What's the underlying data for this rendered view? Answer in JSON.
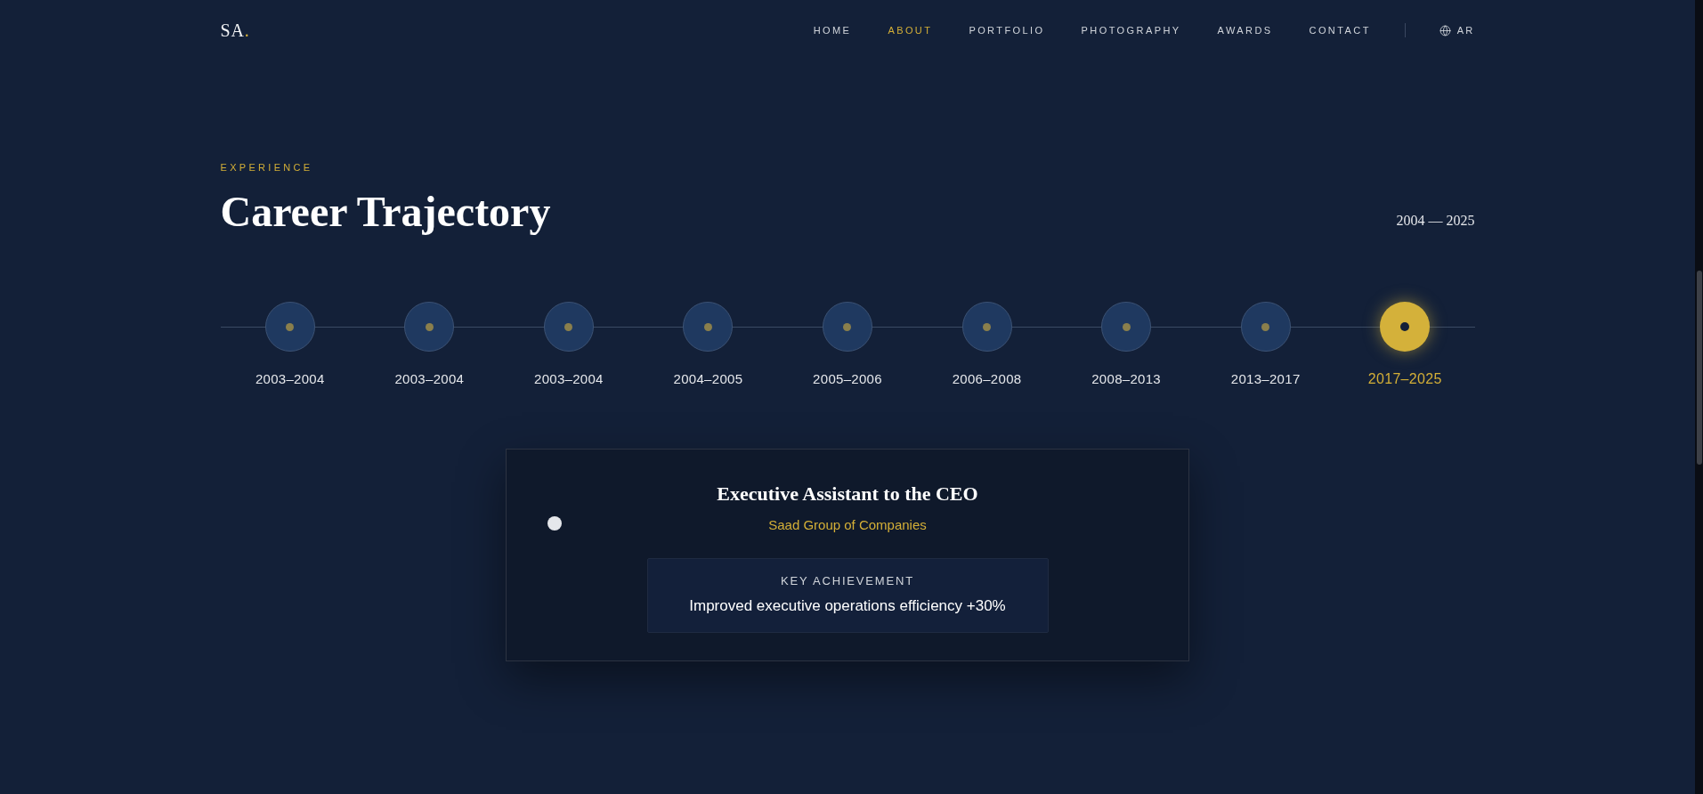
{
  "nav": {
    "logo": {
      "text": "SA",
      "accent": "."
    },
    "links": [
      {
        "label": "HOME",
        "selected": false
      },
      {
        "label": "ABOUT",
        "selected": true
      },
      {
        "label": "PORTFOLIO",
        "selected": false
      },
      {
        "label": "PHOTOGRAPHY",
        "selected": false
      },
      {
        "label": "AWARDS",
        "selected": false
      },
      {
        "label": "CONTACT",
        "selected": false
      }
    ],
    "language": {
      "label": "AR"
    }
  },
  "section": {
    "eyebrow": "EXPERIENCE",
    "title": "Career Trajectory",
    "range": "2004 — 2025"
  },
  "timeline": [
    {
      "period": "2003–2004",
      "selected": false
    },
    {
      "period": "2003–2004",
      "selected": false
    },
    {
      "period": "2003–2004",
      "selected": false
    },
    {
      "period": "2004–2005",
      "selected": false
    },
    {
      "period": "2005–2006",
      "selected": false
    },
    {
      "period": "2006–2008",
      "selected": false
    },
    {
      "period": "2008–2013",
      "selected": false
    },
    {
      "period": "2013–2017",
      "selected": false
    },
    {
      "period": "2017–2025",
      "selected": true
    }
  ],
  "card": {
    "title": "Executive Assistant to the CEO",
    "company": "Saad Group of Companies",
    "achievement": {
      "label": "KEY ACHIEVEMENT",
      "text": "Improved executive operations efficiency +30%"
    }
  }
}
